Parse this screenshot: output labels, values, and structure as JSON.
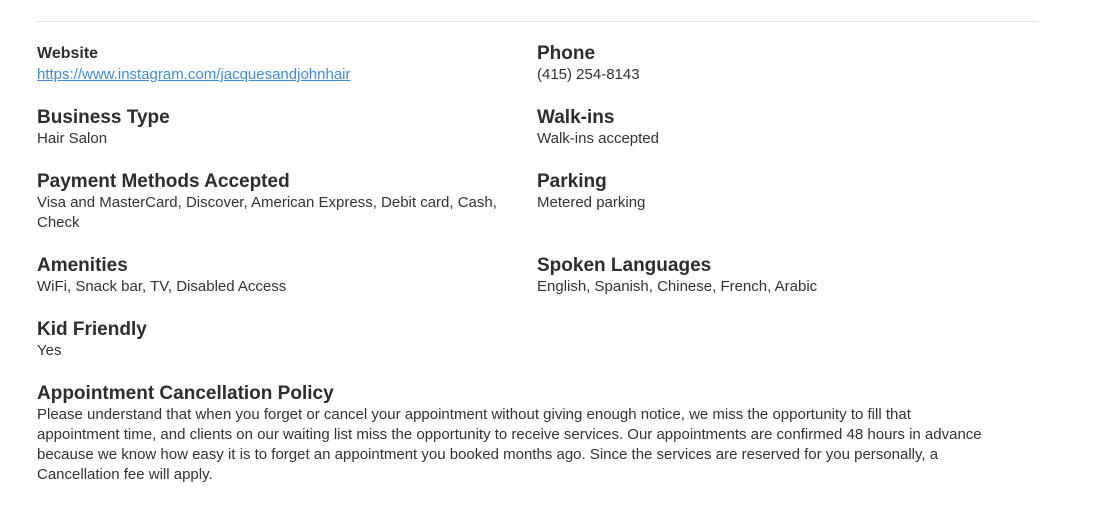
{
  "details": {
    "website": {
      "label": "Website",
      "value": "https://www.instagram.com/jacquesandjohnhair"
    },
    "phone": {
      "label": "Phone",
      "value": "(415) 254-8143"
    },
    "business_type": {
      "label": "Business Type",
      "value": "Hair Salon"
    },
    "walk_ins": {
      "label": "Walk-ins",
      "value": "Walk-ins accepted"
    },
    "payment": {
      "label": "Payment Methods Accepted",
      "value": "Visa and MasterCard, Discover, American Express, Debit card, Cash, Check"
    },
    "parking": {
      "label": "Parking",
      "value": "Metered parking"
    },
    "amenities": {
      "label": "Amenities",
      "value": "WiFi, Snack bar, TV, Disabled Access"
    },
    "languages": {
      "label": "Spoken Languages",
      "value": "English, Spanish, Chinese, French, Arabic"
    },
    "kid_friendly": {
      "label": "Kid Friendly",
      "value": "Yes"
    }
  },
  "policy": {
    "label": "Appointment Cancellation Policy",
    "value": "Please understand that when you forget or cancel your appointment without giving enough notice, we miss the opportunity to fill that appointment time, and clients on our waiting list miss the opportunity to receive services. Our appointments are confirmed 48 hours in advance because we know how easy it is to forget an appointment you booked months ago. Since the services are reserved for you personally, a Cancellation fee will apply."
  },
  "colors": {
    "link": "#3c8ddb",
    "text": "#2d2d2d",
    "divider": "#e3e3e3"
  }
}
